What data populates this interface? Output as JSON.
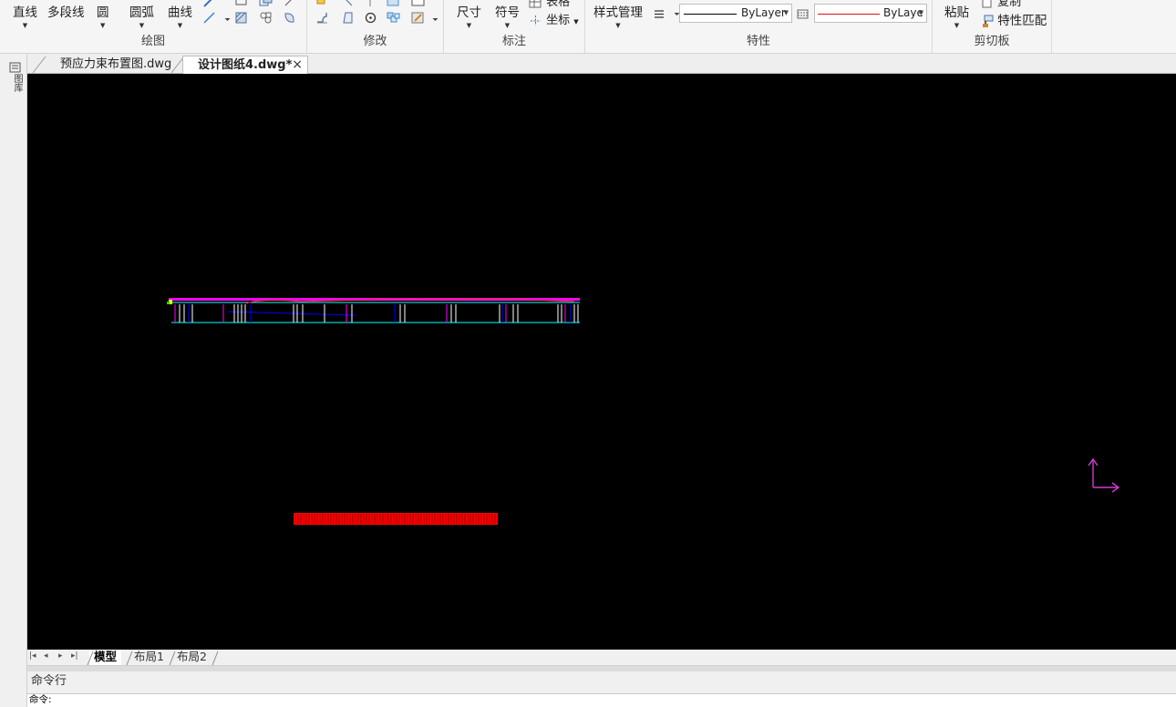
{
  "ribbon": {
    "draw": {
      "label": "绘图",
      "line": "直线",
      "polyline": "多段线",
      "circle": "圆",
      "arc": "圆弧",
      "curve": "曲线"
    },
    "modify": {
      "label": "修改"
    },
    "annotate": {
      "label": "标注",
      "dimension": "尺寸",
      "symbol": "符号",
      "table": "表格",
      "coordinate": "坐标"
    },
    "properties": {
      "label": "特性",
      "style_manager": "样式管理",
      "linetype_value": "ByLayer",
      "color_value": "ByLayе",
      "line_color": "#000000",
      "accent_line_color": "#e01010"
    },
    "clipboard": {
      "label": "剪切板",
      "paste": "粘贴",
      "copy": "复制",
      "match_properties": "特性匹配"
    }
  },
  "tabs": [
    {
      "label": "预应力束布置图.dwg",
      "active": false
    },
    {
      "label": "设计图纸4.dwg*",
      "active": true,
      "close": "×"
    }
  ],
  "leftbar": {
    "label": "图库"
  },
  "layout_tabs": [
    {
      "label": "模型",
      "active": true
    },
    {
      "label": "布局1",
      "active": false
    },
    {
      "label": "布局2",
      "active": false
    }
  ],
  "nav_buttons": [
    "|◂",
    "◂",
    "▸",
    "▸|"
  ],
  "command": {
    "panel_label": "命令行",
    "prompt": "命令:"
  },
  "canvas": {
    "background": "#000000",
    "ucs_color": "#d23ad2",
    "drawing_colors": [
      "#ff00ff",
      "#00ffff",
      "#ffffff",
      "#0000ff",
      "#ff0000",
      "#ffff00",
      "#00ff00"
    ]
  },
  "icons": [
    "pencil-icon",
    "rectangle-icon",
    "copy-icon",
    "arrow-icon",
    "polyline-icon",
    "hatch-icon",
    "move-icon",
    "array-icon",
    "rotate-icon",
    "offset-icon",
    "fillet-icon",
    "stretch-icon",
    "scale-icon",
    "block-icon",
    "edit-icon",
    "linetype-icon",
    "lineweight-icon",
    "table-icon",
    "coordinate-icon",
    "match-properties-icon"
  ]
}
